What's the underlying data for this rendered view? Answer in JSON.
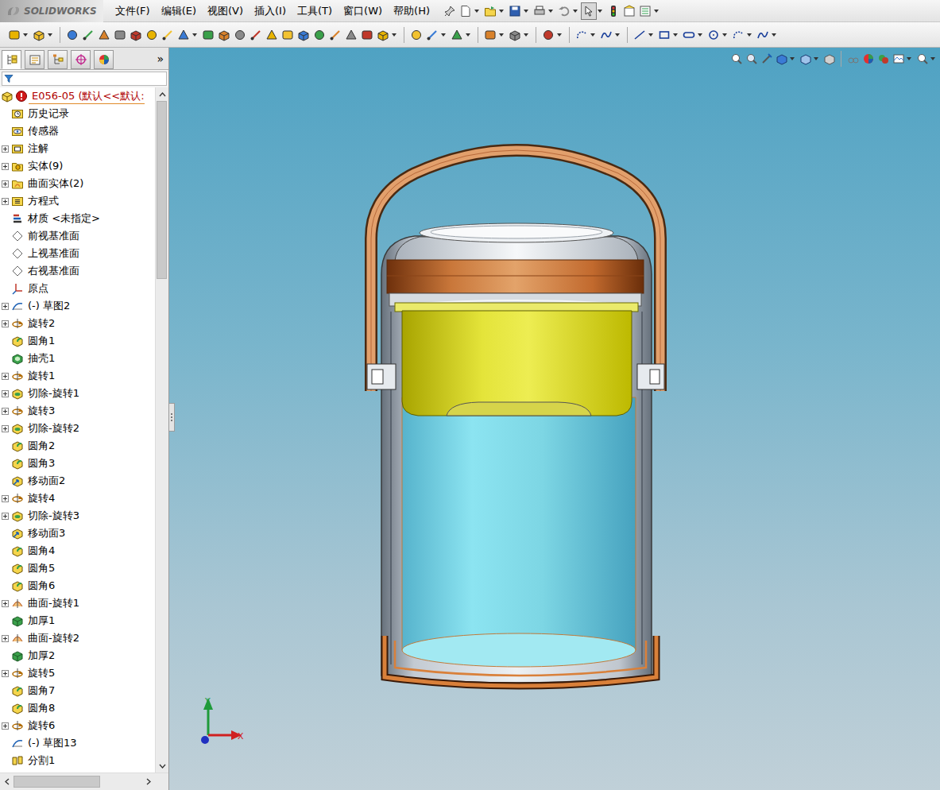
{
  "app": {
    "logo": "SOLIDWORKS"
  },
  "menu": [
    "文件(F)",
    "编辑(E)",
    "视图(V)",
    "插入(I)",
    "工具(T)",
    "窗口(W)",
    "帮助(H)"
  ],
  "panel_tabs": [
    {
      "kind": "feature",
      "selected": true
    },
    {
      "kind": "property",
      "selected": false
    },
    {
      "kind": "configuration",
      "selected": false
    },
    {
      "kind": "dimxpert",
      "selected": false
    },
    {
      "kind": "display",
      "selected": false
    }
  ],
  "panel_more": "»",
  "tree": {
    "root": {
      "label": "E056-05 (默认<<默认:",
      "error": true
    },
    "items": [
      {
        "label": "历史记录",
        "kind": "history",
        "expandable": false
      },
      {
        "label": "传感器",
        "kind": "sensor",
        "expandable": false
      },
      {
        "label": "注解",
        "kind": "annotation",
        "expandable": true
      },
      {
        "label": "实体(9)",
        "kind": "solid",
        "expandable": true
      },
      {
        "label": "曲面实体(2)",
        "kind": "surface",
        "expandable": true
      },
      {
        "label": "方程式",
        "kind": "equation",
        "expandable": true
      },
      {
        "label": "材质 <未指定>",
        "kind": "material",
        "expandable": false
      },
      {
        "label": "前视基准面",
        "kind": "plane",
        "expandable": false
      },
      {
        "label": "上视基准面",
        "kind": "plane",
        "expandable": false
      },
      {
        "label": "右视基准面",
        "kind": "plane",
        "expandable": false
      },
      {
        "label": "原点",
        "kind": "origin",
        "expandable": false
      },
      {
        "label": "(-) 草图2",
        "kind": "sketch",
        "expandable": true
      },
      {
        "label": "旋转2",
        "kind": "revolve",
        "expandable": true
      },
      {
        "label": "圆角1",
        "kind": "fillet",
        "expandable": false
      },
      {
        "label": "抽壳1",
        "kind": "shell",
        "expandable": false
      },
      {
        "label": "旋转1",
        "kind": "revolve",
        "expandable": true
      },
      {
        "label": "切除-旋转1",
        "kind": "cut-revolve",
        "expandable": true
      },
      {
        "label": "旋转3",
        "kind": "revolve",
        "expandable": true
      },
      {
        "label": "切除-旋转2",
        "kind": "cut-revolve",
        "expandable": true
      },
      {
        "label": "圆角2",
        "kind": "fillet",
        "expandable": false
      },
      {
        "label": "圆角3",
        "kind": "fillet",
        "expandable": false
      },
      {
        "label": "移动面2",
        "kind": "move-face",
        "expandable": false
      },
      {
        "label": "旋转4",
        "kind": "revolve",
        "expandable": true
      },
      {
        "label": "切除-旋转3",
        "kind": "cut-revolve",
        "expandable": true
      },
      {
        "label": "移动面3",
        "kind": "move-face",
        "expandable": false
      },
      {
        "label": "圆角4",
        "kind": "fillet",
        "expandable": false
      },
      {
        "label": "圆角5",
        "kind": "fillet",
        "expandable": false
      },
      {
        "label": "圆角6",
        "kind": "fillet",
        "expandable": false
      },
      {
        "label": "曲面-旋转1",
        "kind": "surface-revolve",
        "expandable": true
      },
      {
        "label": "加厚1",
        "kind": "thicken",
        "expandable": false
      },
      {
        "label": "曲面-旋转2",
        "kind": "surface-revolve",
        "expandable": true
      },
      {
        "label": "加厚2",
        "kind": "thicken",
        "expandable": false
      },
      {
        "label": "旋转5",
        "kind": "revolve",
        "expandable": true
      },
      {
        "label": "圆角7",
        "kind": "fillet",
        "expandable": false
      },
      {
        "label": "圆角8",
        "kind": "fillet",
        "expandable": false
      },
      {
        "label": "旋转6",
        "kind": "revolve",
        "expandable": true
      },
      {
        "label": "(-) 草图13",
        "kind": "sketch",
        "expandable": false
      },
      {
        "label": "分割1",
        "kind": "split",
        "expandable": false
      }
    ]
  },
  "vertical_scroll": {
    "level": 0.27
  },
  "horizontal_scroll": {
    "level": 0.68
  },
  "triad": {
    "x": "X",
    "y": "Y"
  }
}
